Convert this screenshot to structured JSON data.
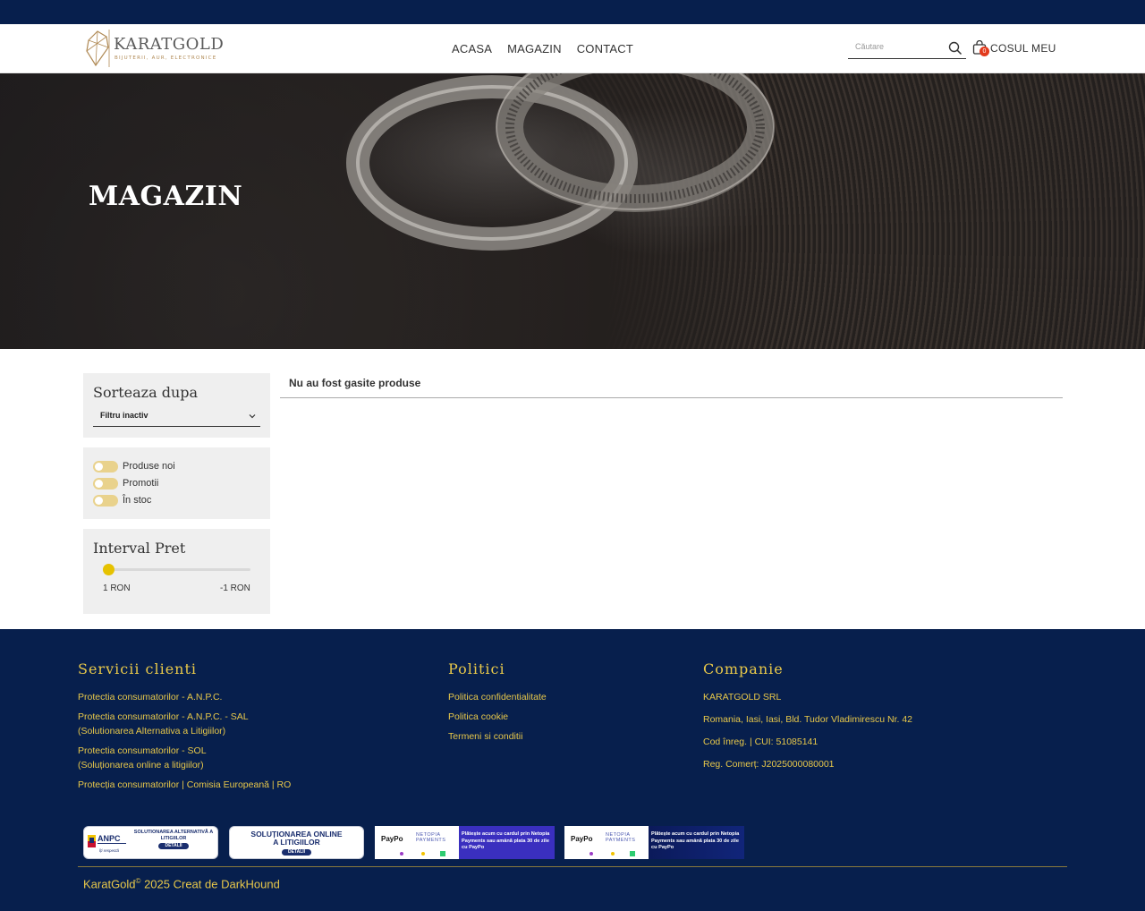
{
  "header": {
    "logo_name": "KARATGOLD",
    "logo_tagline": "BIJUTERII, AUR, ELECTRONICE",
    "nav": [
      "ACASA",
      "MAGAZIN",
      "CONTACT"
    ],
    "search_placeholder": "Căutare",
    "cart_count": "0",
    "cart_label": "COSUL MEU"
  },
  "hero": {
    "title": "MAGAZIN"
  },
  "sidebar": {
    "sort_title": "Sorteaza dupa",
    "sort_value": "Filtru inactiv",
    "toggles": [
      "Produse noi",
      "Promotii",
      "În stoc"
    ],
    "price_title": "Interval Pret",
    "price_min": "1 RON",
    "price_max": "-1 RON"
  },
  "results": {
    "message": "Nu au fost gasite produse"
  },
  "footer": {
    "col1": {
      "title": "Servicii clienti",
      "links": [
        "Protectia consumatorilor - A.N.P.C.",
        "Protectia consumatorilor - A.N.P.C. - SAL",
        "(Solutionarea Alternativa a Litigiilor)",
        "Protectia consumatorilor - SOL",
        "(Soluționarea online a litigiilor)",
        "Protecția consumatorilor | Comisia Europeană | RO"
      ]
    },
    "col2": {
      "title": "Politici",
      "links": [
        "Politica confidentialitate",
        "Politica cookie",
        "Termeni si conditii"
      ]
    },
    "col3": {
      "title": "Companie",
      "lines": [
        "KARATGOLD SRL",
        "Romania, Iasi, Iasi, Bld. Tudor Vladimirescu Nr. 42",
        "Cod înreg. | CUI: 51085141",
        "Reg. Comerț: J2025000080001"
      ]
    },
    "badges": {
      "anpc_name": "ANPC",
      "anpc_sub": "Îți respectă",
      "anpc_text": "SOLUTIONAREA ALTERNATIVĂ A LITIGIILOR",
      "sol_line1": "SOLUȚIONAREA ONLINE",
      "sol_line2": "A LITIGIILOR",
      "details": "DETALII",
      "paypo": "PayPo",
      "netopia": "NETOPIA PAYMENTS",
      "pay_text": "Plătește acum cu cardul prin Netopia Payments sau amână plata 30 de zile cu PayPo"
    },
    "copyright_brand": "KaratGold",
    "copyright_symbol": "©",
    "copyright_rest": " 2025 Creat de DarkHound"
  },
  "colors": {
    "navy": "#071f4d",
    "gold": "#e8c84a",
    "toggle": "#e9d28c",
    "slider": "#e6c200",
    "badge_red": "#e23a1c"
  }
}
